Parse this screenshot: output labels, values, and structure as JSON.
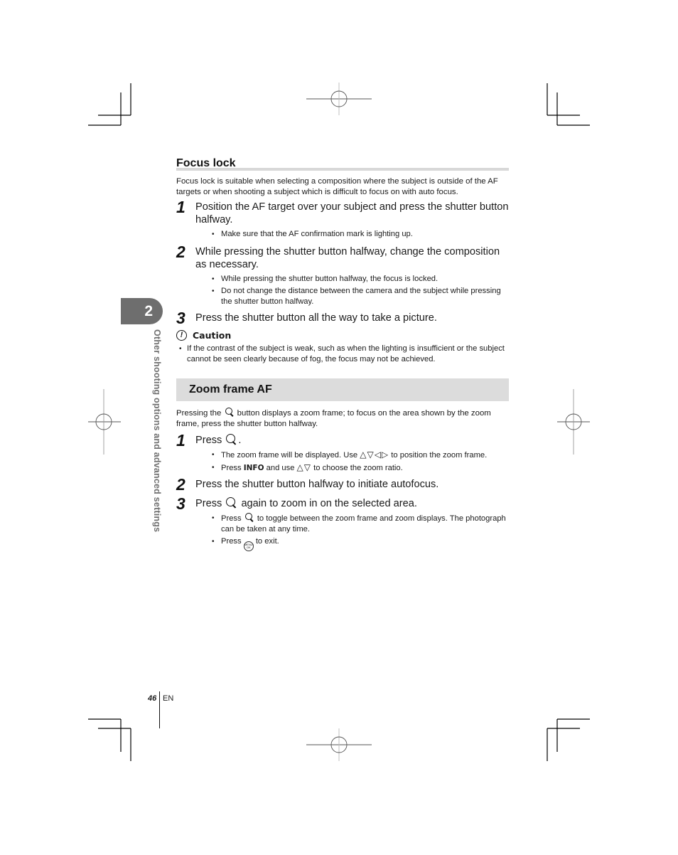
{
  "chapter": {
    "number": "2",
    "side_label": "Other shooting options and advanced settings"
  },
  "focus_lock": {
    "title": "Focus lock",
    "intro": "Focus lock is suitable when selecting a composition where the subject is outside of the AF targets or when shooting a subject which is difficult to focus on with auto focus.",
    "steps": [
      {
        "number": "1",
        "text": "Position the AF target over your subject and press the shutter button halfway.",
        "bullets": [
          "Make sure that the AF confirmation mark is lighting up."
        ]
      },
      {
        "number": "2",
        "text": "While pressing the shutter button halfway, change the composition as necessary.",
        "bullets": [
          "While pressing the shutter button halfway, the focus is locked.",
          "Do not change the distance between the camera and the subject while pressing the shutter button halfway."
        ]
      },
      {
        "number": "3",
        "text": "Press the shutter button all the way to take a picture.",
        "bullets": []
      }
    ],
    "caution": {
      "icon": "caution-icon",
      "glyph": "!",
      "label": "Caution",
      "items": [
        "If the contrast of the subject is weak, such as when the lighting is insufficient or the subject cannot be seen clearly because of fog, the focus may not be achieved."
      ]
    }
  },
  "zoom_frame_af": {
    "title": "Zoom frame AF",
    "intro_before": "Pressing the",
    "intro_after": "button displays a zoom frame; to focus on the area shown by the zoom frame, press the shutter button halfway.",
    "steps": [
      {
        "number": "1",
        "text_before": "Press",
        "text_after": ".",
        "bullets": [
          {
            "before": "The zoom frame will be displayed. Use",
            "arrows": "△▽◁▷",
            "after": "to position the zoom frame."
          },
          {
            "before": "Press",
            "key": "INFO",
            "mid": "and use",
            "arrows": "△▽",
            "after": "to choose the zoom ratio."
          }
        ]
      },
      {
        "number": "2",
        "text": "Press the shutter button halfway to initiate autofocus."
      },
      {
        "number": "3",
        "text_before": "Press",
        "text_after": "again to zoom in on the selected area.",
        "bullets": [
          {
            "before": "Press",
            "after": "to toggle between the zoom frame and zoom displays. The photograph can be taken at any time."
          },
          {
            "before": "Press",
            "button": "MENU OK",
            "after": "to exit."
          }
        ]
      }
    ]
  },
  "footer": {
    "page_number": "46",
    "language": "EN"
  }
}
